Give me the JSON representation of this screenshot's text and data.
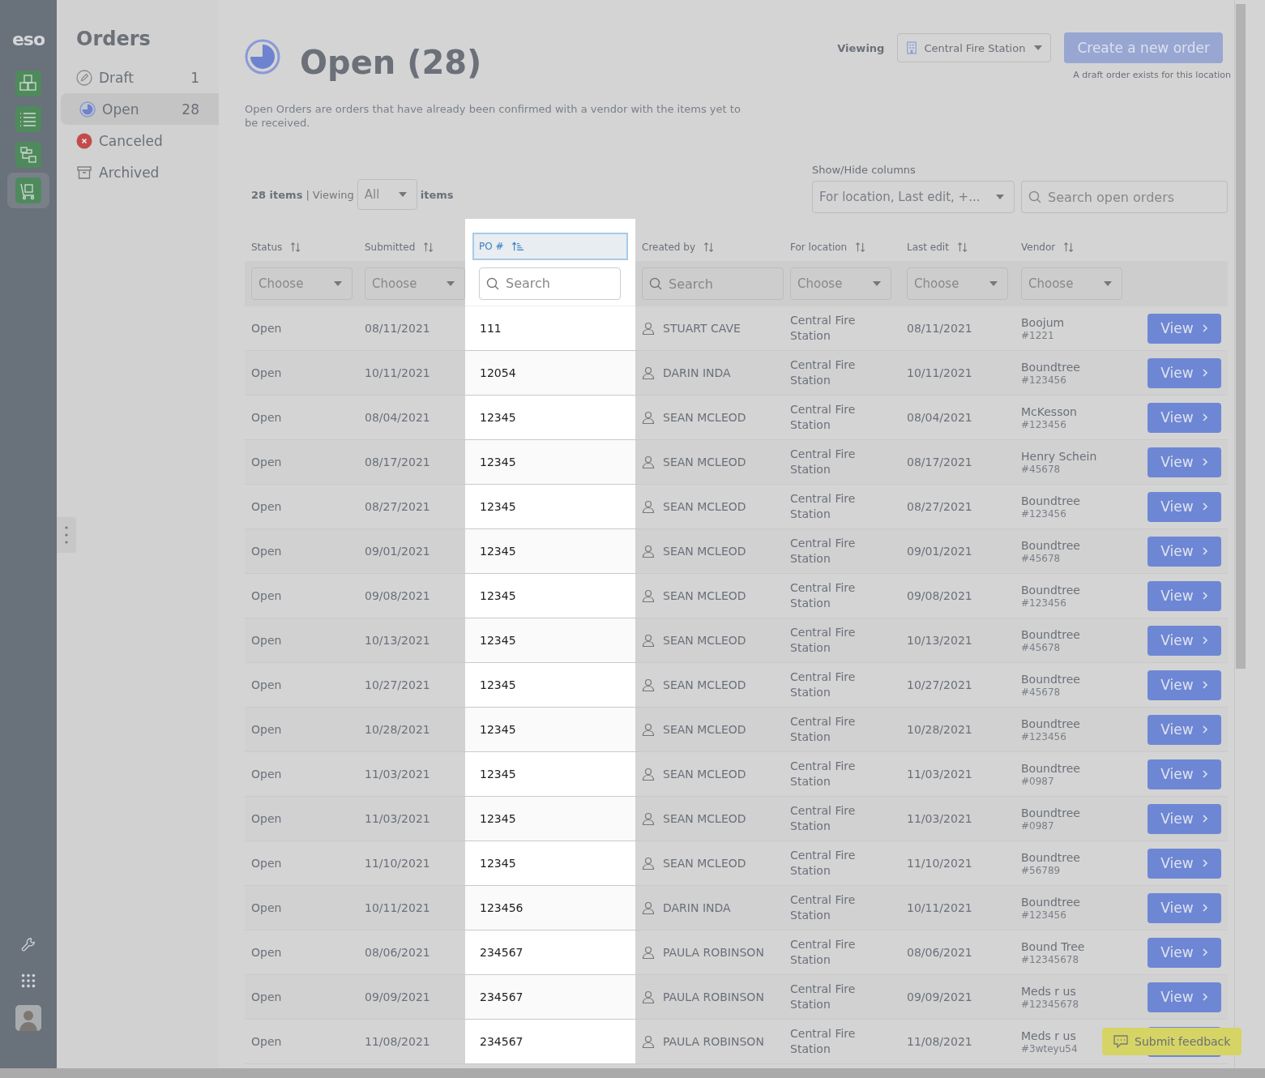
{
  "rail": {
    "logo": "eso",
    "items": [
      {
        "selected": false
      },
      {
        "selected": false
      },
      {
        "selected": false
      },
      {
        "selected": true
      }
    ]
  },
  "sidebar": {
    "title": "Orders",
    "items": [
      {
        "label": "Draft",
        "count": "1",
        "selected": false
      },
      {
        "label": "Open",
        "count": "28",
        "selected": true
      },
      {
        "label": "Canceled",
        "selected": false
      },
      {
        "label": "Archived",
        "selected": false
      }
    ]
  },
  "header": {
    "title": "Open (28)",
    "description": "Open Orders are orders that have already been confirmed with a vendor with the items yet to be received.",
    "viewing_label": "Viewing",
    "location": "Central Fire Station",
    "create_button": {
      "label": "Create a new order",
      "disabled": true
    },
    "note": "A draft order exists for this location"
  },
  "toolbar": {
    "count": "28 items",
    "separator": "|",
    "viewing": "Viewing",
    "viewing_value": "All",
    "items": "items",
    "columns_label": "Show/Hide columns",
    "columns_value": "For location, Last edit, +...",
    "search_placeholder": "Search open orders"
  },
  "columns": [
    {
      "label": "Status",
      "sorted": false,
      "highlighted": false,
      "filter": {
        "kind": "select",
        "placeholder": "Choose"
      }
    },
    {
      "label": "Submitted",
      "sorted": false,
      "highlighted": false,
      "filter": {
        "kind": "select",
        "placeholder": "Choose"
      }
    },
    {
      "label": "PO #",
      "sorted": true,
      "highlighted": true,
      "filter": {
        "kind": "search",
        "placeholder": "Search"
      }
    },
    {
      "label": "Created by",
      "sorted": false,
      "highlighted": false,
      "filter": {
        "kind": "search",
        "placeholder": "Search"
      }
    },
    {
      "label": "For location",
      "sorted": false,
      "highlighted": false,
      "filter": {
        "kind": "select",
        "placeholder": "Choose"
      }
    },
    {
      "label": "Last edit",
      "sorted": false,
      "highlighted": false,
      "filter": {
        "kind": "select",
        "placeholder": "Choose"
      }
    },
    {
      "label": "Vendor",
      "sorted": false,
      "highlighted": false,
      "filter": {
        "kind": "select",
        "placeholder": "Choose"
      }
    }
  ],
  "rows": [
    {
      "status": "Open",
      "submitted": "08/11/2021",
      "po": "111",
      "created_by": "STUART CAVE",
      "location": "Central Fire Station",
      "last_edit": "08/11/2021",
      "vendor": "Boojum",
      "vendor_number": "#1221",
      "action": "View"
    },
    {
      "status": "Open",
      "submitted": "10/11/2021",
      "po": "12054",
      "created_by": "DARIN INDA",
      "location": "Central Fire Station",
      "last_edit": "10/11/2021",
      "vendor": "Boundtree",
      "vendor_number": "#123456",
      "action": "View"
    },
    {
      "status": "Open",
      "submitted": "08/04/2021",
      "po": "12345",
      "created_by": "SEAN MCLEOD",
      "location": "Central Fire Station",
      "last_edit": "08/04/2021",
      "vendor": "McKesson",
      "vendor_number": "#123456",
      "action": "View"
    },
    {
      "status": "Open",
      "submitted": "08/17/2021",
      "po": "12345",
      "created_by": "SEAN MCLEOD",
      "location": "Central Fire Station",
      "last_edit": "08/17/2021",
      "vendor": "Henry Schein",
      "vendor_number": "#45678",
      "action": "View"
    },
    {
      "status": "Open",
      "submitted": "08/27/2021",
      "po": "12345",
      "created_by": "SEAN MCLEOD",
      "location": "Central Fire Station",
      "last_edit": "08/27/2021",
      "vendor": "Boundtree",
      "vendor_number": "#123456",
      "action": "View"
    },
    {
      "status": "Open",
      "submitted": "09/01/2021",
      "po": "12345",
      "created_by": "SEAN MCLEOD",
      "location": "Central Fire Station",
      "last_edit": "09/01/2021",
      "vendor": "Boundtree",
      "vendor_number": "#45678",
      "action": "View"
    },
    {
      "status": "Open",
      "submitted": "09/08/2021",
      "po": "12345",
      "created_by": "SEAN MCLEOD",
      "location": "Central Fire Station",
      "last_edit": "09/08/2021",
      "vendor": "Boundtree",
      "vendor_number": "#123456",
      "action": "View"
    },
    {
      "status": "Open",
      "submitted": "10/13/2021",
      "po": "12345",
      "created_by": "SEAN MCLEOD",
      "location": "Central Fire Station",
      "last_edit": "10/13/2021",
      "vendor": "Boundtree",
      "vendor_number": "#45678",
      "action": "View"
    },
    {
      "status": "Open",
      "submitted": "10/27/2021",
      "po": "12345",
      "created_by": "SEAN MCLEOD",
      "location": "Central Fire Station",
      "last_edit": "10/27/2021",
      "vendor": "Boundtree",
      "vendor_number": "#45678",
      "action": "View"
    },
    {
      "status": "Open",
      "submitted": "10/28/2021",
      "po": "12345",
      "created_by": "SEAN MCLEOD",
      "location": "Central Fire Station",
      "last_edit": "10/28/2021",
      "vendor": "Boundtree",
      "vendor_number": "#123456",
      "action": "View"
    },
    {
      "status": "Open",
      "submitted": "11/03/2021",
      "po": "12345",
      "created_by": "SEAN MCLEOD",
      "location": "Central Fire Station",
      "last_edit": "11/03/2021",
      "vendor": "Boundtree",
      "vendor_number": "#0987",
      "action": "View"
    },
    {
      "status": "Open",
      "submitted": "11/03/2021",
      "po": "12345",
      "created_by": "SEAN MCLEOD",
      "location": "Central Fire Station",
      "last_edit": "11/03/2021",
      "vendor": "Boundtree",
      "vendor_number": "#0987",
      "action": "View"
    },
    {
      "status": "Open",
      "submitted": "11/10/2021",
      "po": "12345",
      "created_by": "SEAN MCLEOD",
      "location": "Central Fire Station",
      "last_edit": "11/10/2021",
      "vendor": "Boundtree",
      "vendor_number": "#56789",
      "action": "View"
    },
    {
      "status": "Open",
      "submitted": "10/11/2021",
      "po": "123456",
      "created_by": "DARIN INDA",
      "location": "Central Fire Station",
      "last_edit": "10/11/2021",
      "vendor": "Boundtree",
      "vendor_number": "#123456",
      "action": "View"
    },
    {
      "status": "Open",
      "submitted": "08/06/2021",
      "po": "234567",
      "created_by": "PAULA ROBINSON",
      "location": "Central Fire Station",
      "last_edit": "08/06/2021",
      "vendor": "Bound Tree",
      "vendor_number": "#12345678",
      "action": "View"
    },
    {
      "status": "Open",
      "submitted": "09/09/2021",
      "po": "234567",
      "created_by": "PAULA ROBINSON",
      "location": "Central Fire Station",
      "last_edit": "09/09/2021",
      "vendor": "Meds r us",
      "vendor_number": "#12345678",
      "action": "View"
    },
    {
      "status": "Open",
      "submitted": "11/08/2021",
      "po": "234567",
      "created_by": "PAULA ROBINSON",
      "location": "Central Fire Station",
      "last_edit": "11/08/2021",
      "vendor": "Meds r us",
      "vendor_number": "#3wteyu54"
    }
  ],
  "feedback_button": "Submit feedback"
}
